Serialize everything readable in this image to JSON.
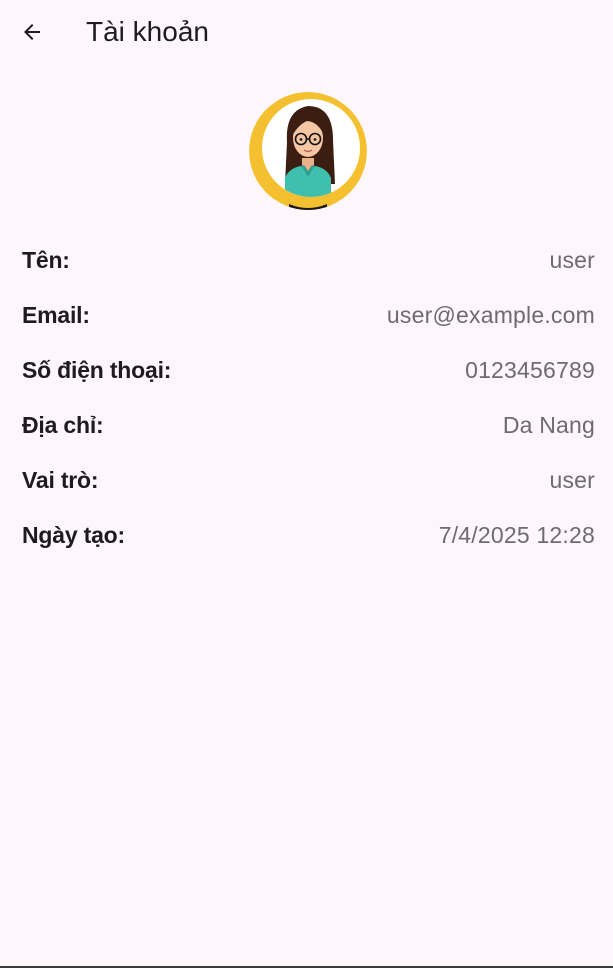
{
  "app_bar": {
    "title": "Tài khoản",
    "back_icon": "arrow-back-icon"
  },
  "avatar": {
    "icon": "female-user-avatar-icon",
    "colors": {
      "ring": "#f2b928",
      "ring_shadow": "#d9a21f",
      "hair": "#3b1d12",
      "skin": "#f7c6a3",
      "shirt": "#3fbfad",
      "glasses": "#111111"
    }
  },
  "profile": {
    "name": {
      "label": "Tên:",
      "value": "user"
    },
    "email": {
      "label": "Email:",
      "value": "user@example.com"
    },
    "phone": {
      "label": "Số điện thoại:",
      "value": "0123456789"
    },
    "address": {
      "label": "Địa chỉ:",
      "value": "Da Nang"
    },
    "role": {
      "label": "Vai trò:",
      "value": "user"
    },
    "created": {
      "label": "Ngày tạo:",
      "value": "7/4/2025 12:28"
    }
  },
  "theme": {
    "background": "#fdf7fc",
    "text_primary": "#1d1b20",
    "text_secondary": "#6e6a72"
  }
}
